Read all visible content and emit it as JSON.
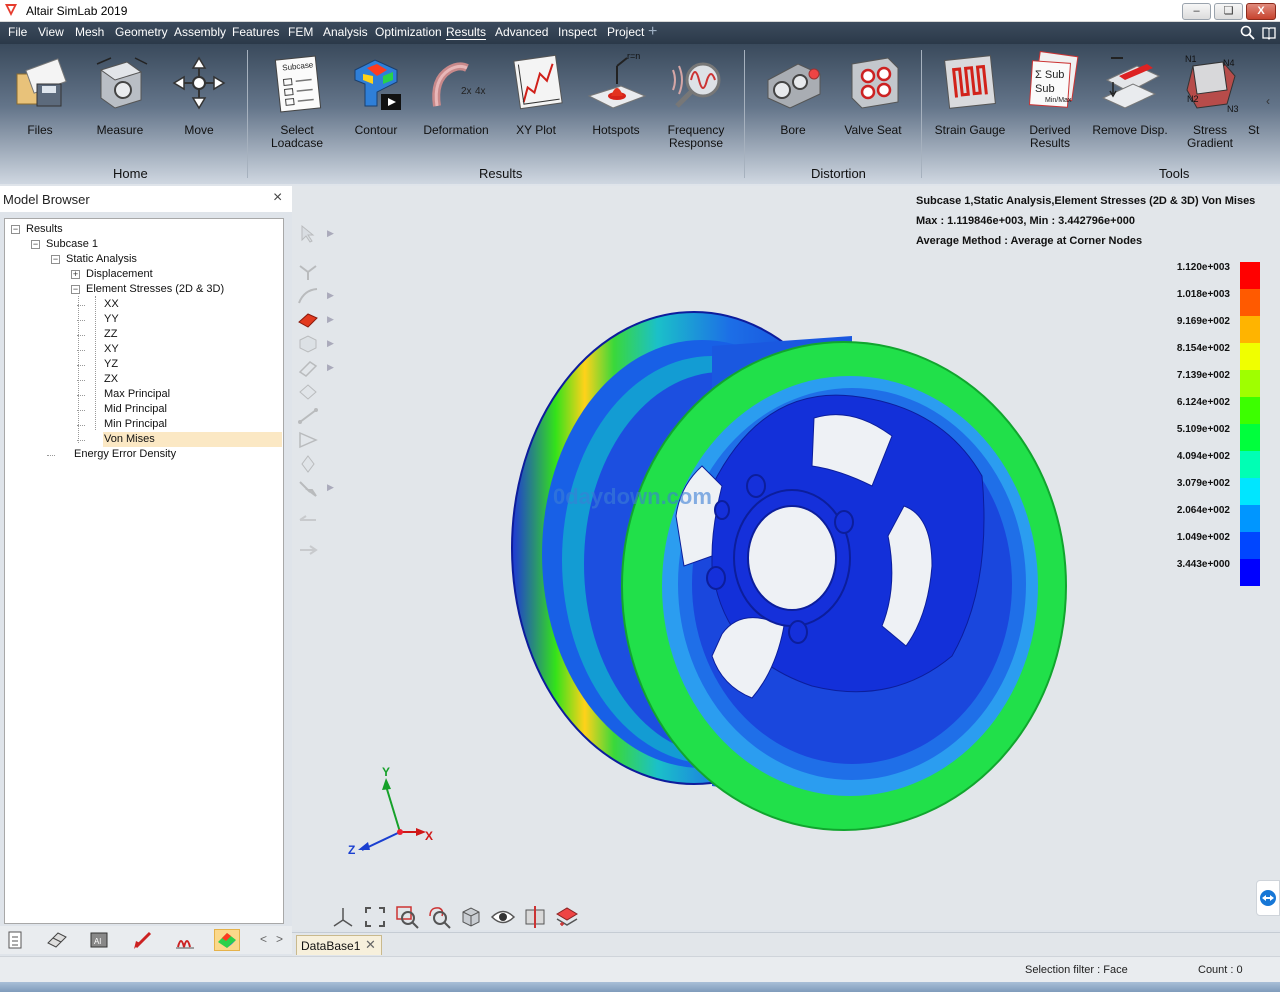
{
  "window": {
    "title": "Altair SimLab 2019",
    "min_glyph": "–",
    "max_glyph": "❏",
    "close_glyph": "X"
  },
  "menu": {
    "items": [
      "File",
      "View",
      "Mesh",
      "Geometry",
      "Assembly",
      "Features",
      "FEM",
      "Analysis",
      "Optimization",
      "Results",
      "Advanced",
      "Inspect",
      "Project"
    ],
    "active": "Results",
    "plus": "+"
  },
  "ribbon": {
    "buttons": [
      {
        "label": "Files",
        "icon": "files-icon"
      },
      {
        "label": "Measure",
        "icon": "measure-icon"
      },
      {
        "label": "Move",
        "icon": "move-icon"
      },
      {
        "label": "Select Loadcase",
        "icon": "select-loadcase-icon"
      },
      {
        "label": "Contour",
        "icon": "contour-icon"
      },
      {
        "label": "Deformation",
        "icon": "deformation-icon"
      },
      {
        "label": "XY Plot",
        "icon": "xy-plot-icon"
      },
      {
        "label": "Hotspots",
        "icon": "hotspots-icon"
      },
      {
        "label": "Frequency Response",
        "icon": "frequency-response-icon"
      },
      {
        "label": "Bore",
        "icon": "bore-icon"
      },
      {
        "label": "Valve Seat",
        "icon": "valve-seat-icon"
      },
      {
        "label": "Strain Gauge",
        "icon": "strain-gauge-icon"
      },
      {
        "label": "Derived Results",
        "icon": "derived-results-icon"
      },
      {
        "label": "Remove Disp.",
        "icon": "remove-disp-icon"
      },
      {
        "label": "Stress Gradient",
        "icon": "stress-gradient-icon"
      },
      {
        "label": "St",
        "icon": "overflow-icon"
      }
    ],
    "groups": [
      "Home",
      "Results",
      "Distortion",
      "Tools"
    ],
    "icon_text": {
      "subcase": "Subcase",
      "deform_2x": "2x",
      "deform_4x": "4x",
      "hotspot_r": "r=n",
      "derived_sum": "Σ Sub",
      "derived_sub": "Sub",
      "derived_minmax": "Min/Max",
      "n1": "N1",
      "n2": "N2",
      "n3": "N3",
      "n4": "N4"
    },
    "overflow_glyph": "‹"
  },
  "browser": {
    "title": "Model Browser",
    "close_glyph": "×",
    "tree": [
      {
        "label": "Results",
        "level": 0,
        "toggle": "−"
      },
      {
        "label": "Subcase 1",
        "level": 1,
        "toggle": "−"
      },
      {
        "label": "Static Analysis",
        "level": 2,
        "toggle": "−"
      },
      {
        "label": "Displacement",
        "level": 3,
        "toggle": "+"
      },
      {
        "label": "Element Stresses (2D & 3D)",
        "level": 3,
        "toggle": "−"
      },
      {
        "label": "XX",
        "level": 4
      },
      {
        "label": "YY",
        "level": 4
      },
      {
        "label": "ZZ",
        "level": 4
      },
      {
        "label": "XY",
        "level": 4
      },
      {
        "label": "YZ",
        "level": 4
      },
      {
        "label": "ZX",
        "level": 4
      },
      {
        "label": "Max Principal",
        "level": 4
      },
      {
        "label": "Mid Principal",
        "level": 4
      },
      {
        "label": "Min Principal",
        "level": 4
      },
      {
        "label": "Von Mises",
        "level": 4,
        "selected": true
      },
      {
        "label": "Energy Error Density",
        "level": 3
      }
    ],
    "bottom_tabs": [
      "list-tab-icon",
      "mesh-tab-icon",
      "materials-tab-icon",
      "load-tab-icon",
      "graph-tab-icon",
      "results-tab-icon"
    ],
    "nav_glyphs": [
      "<",
      ">"
    ]
  },
  "results": {
    "line1": "Subcase 1,Static Analysis,Element Stresses (2D & 3D) Von Mises",
    "line2": "Max : 1.119846e+003, Min : 3.442796e+000",
    "line3": "Average Method : Average at Corner Nodes"
  },
  "legend": {
    "values": [
      "1.120e+003",
      "1.018e+003",
      "9.169e+002",
      "8.154e+002",
      "7.139e+002",
      "6.124e+002",
      "5.109e+002",
      "4.094e+002",
      "3.079e+002",
      "2.064e+002",
      "1.049e+002",
      "3.443e+000"
    ],
    "colors": [
      "#ff0000",
      "#ff5a00",
      "#ffb400",
      "#f0ff00",
      "#9fff00",
      "#3cff00",
      "#00ff3c",
      "#00ffb4",
      "#00e6ff",
      "#0096ff",
      "#0046ff",
      "#0000ff"
    ]
  },
  "watermark": "0daydown.com",
  "axis": {
    "x": "X",
    "y": "Y",
    "z": "Z"
  },
  "viewport_tools": [
    "select-icon",
    "snap-icon",
    "curve-icon",
    "face-icon",
    "solid-icon",
    "edge-icon",
    "surface-icon",
    "line-icon",
    "plane-icon",
    "point-icon",
    "brush-icon",
    "undo-icon",
    "redo-icon"
  ],
  "viewport_bottom_tools": [
    "axes-icon",
    "fit-icon",
    "zoom-box-icon",
    "zoom-lasso-icon",
    "view-cube-icon",
    "visibility-icon",
    "section-icon",
    "display-icon"
  ],
  "tab": {
    "label": "DataBase1",
    "close_glyph": "✕"
  },
  "status": {
    "filter": "Selection filter : Face",
    "count": "Count : 0"
  }
}
